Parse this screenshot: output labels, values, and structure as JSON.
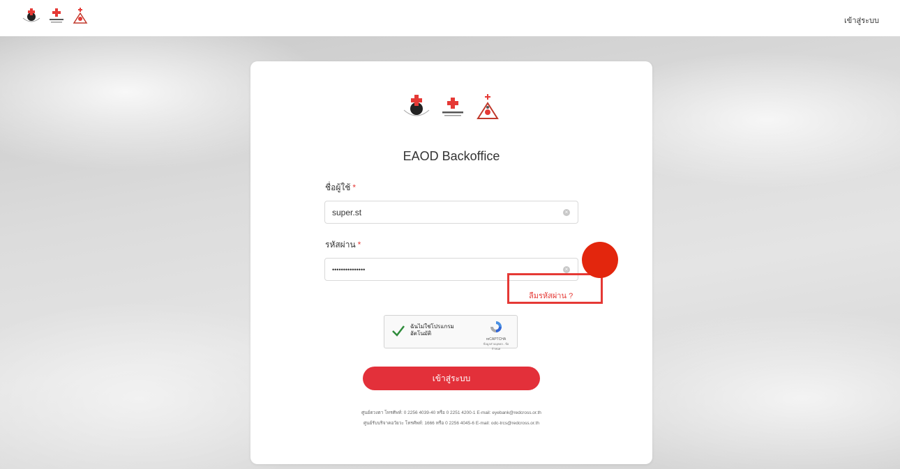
{
  "header": {
    "login_link": "เข้าสู่ระบบ"
  },
  "card": {
    "title": "EAOD Backoffice",
    "username": {
      "label": "ชื่อผู้ใช้",
      "required_mark": "*",
      "value": "super.st"
    },
    "password": {
      "label": "รหัสผ่าน",
      "required_mark": "*",
      "value": "•••••••••••••••"
    },
    "forgot_password": "ลืมรหัสผ่าน ?",
    "captcha": {
      "label": "ฉันไม่ใช่โปรแกรมอัตโนมัติ",
      "brand": "reCAPTCHA",
      "sub": "ข้อมูลส่วนบุคคล - ข้อกำหนด"
    },
    "login_button": "เข้าสู่ระบบ",
    "footer": {
      "line1": "ศูนย์ดวงตา โทรศัพท์: 0 2256 4039-40 หรือ 0 2251 4200-1 E-mail: eyebank@redcross.or.th",
      "line2": "ศูนย์รับบริจาคอวัยวะ โทรศัพท์: 1666 หรือ 0 2256 4045-6 E-mail: odc-trcs@redcross.or.th"
    }
  },
  "colors": {
    "accent": "#e3303a",
    "annotation": "#e53935"
  }
}
